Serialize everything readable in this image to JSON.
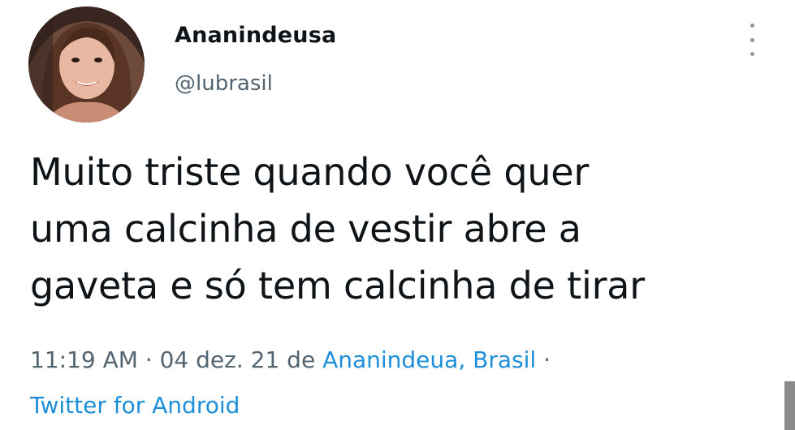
{
  "author": {
    "display_name": "Ananindeusa",
    "handle": "@lubrasil",
    "avatar_icon": "user-photo-avatar"
  },
  "tweet": {
    "text": "Muito triste quando você quer\numa calcinha de vestir abre a\ngaveta e só tem calcinha de tirar",
    "time": "11:19 AM",
    "separator": " · ",
    "date": "04 dez. 21",
    "location_prefix": " de ",
    "location": "Ananindeua, Brasil",
    "separator2": " ·",
    "source": "Twitter for Android"
  },
  "more_icon": "more-vertical-icon",
  "colors": {
    "text": "#0f1419",
    "secondary": "#536471",
    "link": "#1d8fd9",
    "background": "#ffffff"
  }
}
